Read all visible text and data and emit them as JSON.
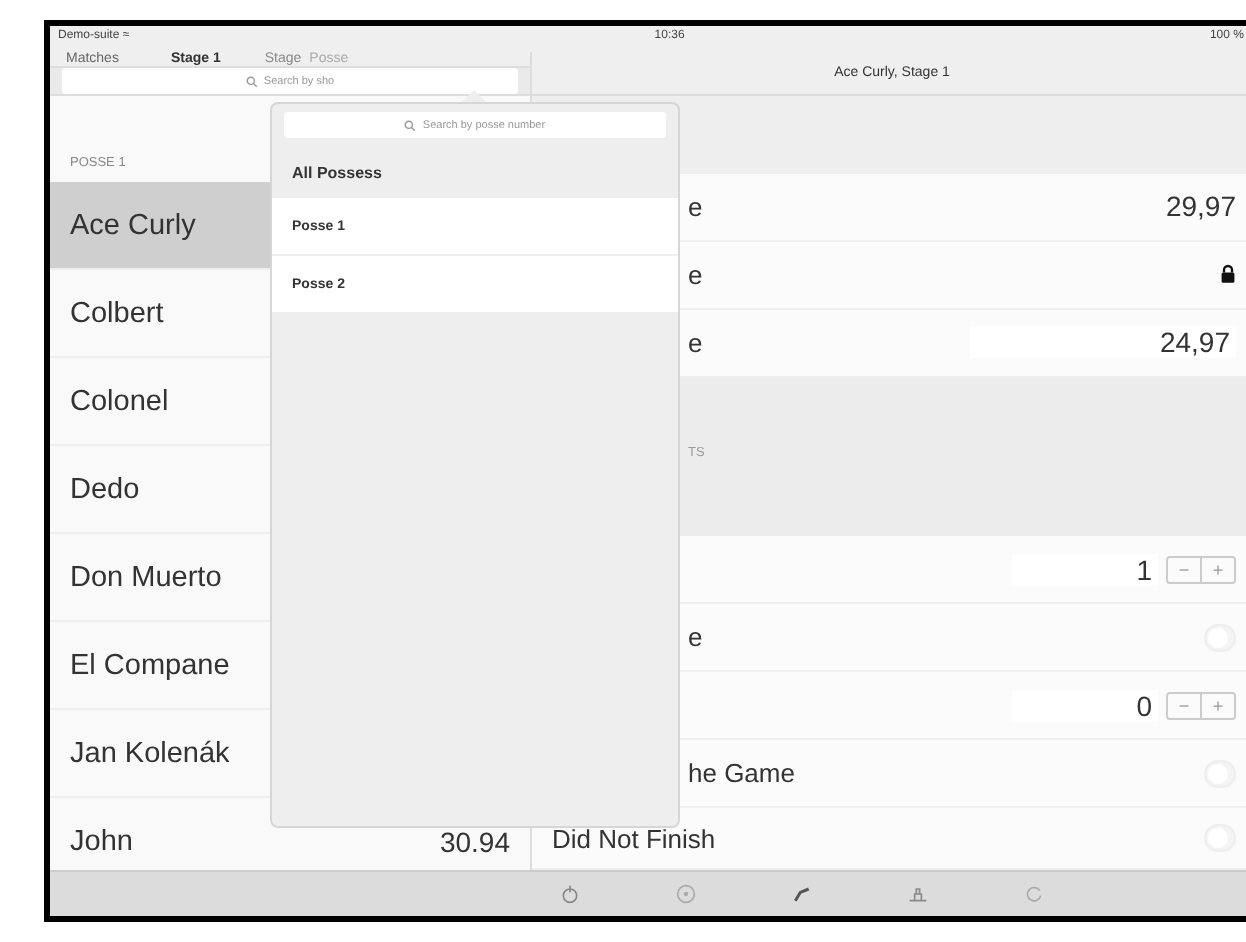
{
  "status_bar": {
    "carrier": "Demo-suite ≈",
    "time": "10:36",
    "battery": "100 %"
  },
  "master": {
    "back": "Matches",
    "title": "Stage 1",
    "segments": [
      {
        "label": "Stage",
        "selected": false
      },
      {
        "label": "Posse",
        "selected": true
      }
    ],
    "search": {
      "placeholder": "Search by sho"
    },
    "section": "POSSE 1",
    "shooters": [
      {
        "name": "Ace Curly",
        "selected": true
      },
      {
        "name": "Colbert",
        "selected": false
      },
      {
        "name": "Colonel",
        "selected": false
      },
      {
        "name": "Dedo",
        "selected": false
      },
      {
        "name": "Don Muerto",
        "selected": false
      },
      {
        "name": "El Compane",
        "selected": false
      },
      {
        "name": "Jan Kolenák",
        "selected": false
      },
      {
        "name": "John",
        "time": "30.94",
        "selected": false
      }
    ]
  },
  "detail": {
    "title": "Ace Curly, Stage 1",
    "rows": [
      {
        "kind": "value",
        "label": "e",
        "value": "29,97"
      },
      {
        "kind": "lock",
        "label": "e"
      },
      {
        "kind": "field",
        "label": "e",
        "value": "24,97"
      },
      {
        "kind": "section",
        "label": "TS"
      },
      {
        "kind": "stepper",
        "value": "1",
        "minus": "−",
        "plus": "+"
      },
      {
        "kind": "toggle",
        "label": "e",
        "on": false
      },
      {
        "kind": "stepper",
        "value": "0",
        "minus": "−",
        "plus": "+"
      },
      {
        "kind": "toggle",
        "label": "he Game",
        "on": false
      },
      {
        "kind": "toggle",
        "label": "Did Not Finish",
        "on": false
      }
    ]
  },
  "popover": {
    "search": {
      "placeholder": "Search by posse number"
    },
    "header": "All Possess",
    "items": [
      {
        "label": "Posse 1"
      },
      {
        "label": "Posse 2"
      }
    ]
  }
}
